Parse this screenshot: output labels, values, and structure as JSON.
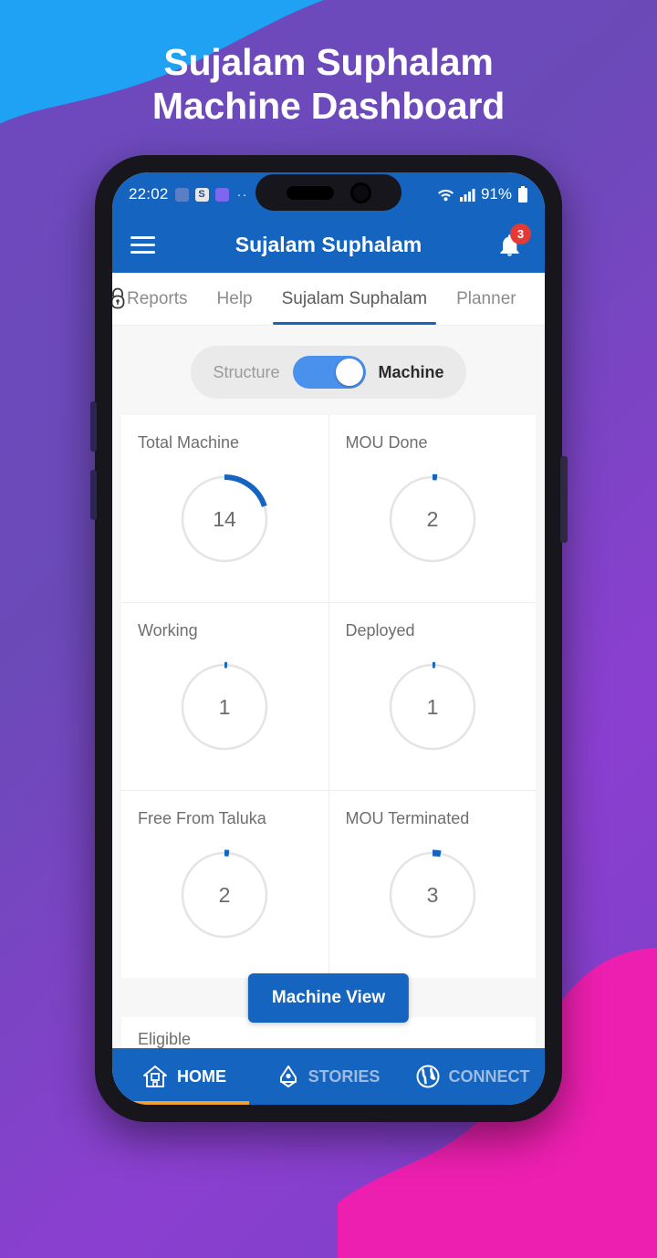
{
  "poster": {
    "headline_line1": "Sujalam Suphalam",
    "headline_line2": "Machine Dashboard",
    "bg_purple": "#6f49c0",
    "bg_cyan": "#1fa2f3",
    "bg_pink": "#ed1fb0"
  },
  "statusbar": {
    "time": "22:02",
    "app_icons": [
      "copy-icon",
      "s-app-icon",
      "chat-app-icon"
    ],
    "overflow": "··",
    "wifi": "wifi-icon",
    "signal": "signal-bars-icon",
    "battery_percent": "91%",
    "battery": "battery-icon"
  },
  "appbar": {
    "menu_icon": "hamburger-menu-icon",
    "title": "Sujalam Suphalam",
    "bell_icon": "notification-bell-icon",
    "badge_count": "3",
    "bg": "#1565c0"
  },
  "tabs": {
    "lock_icon": "lock-icon",
    "items": [
      {
        "label": "Reports",
        "active": false
      },
      {
        "label": "Help",
        "active": false
      },
      {
        "label": "Sujalam Suphalam",
        "active": true
      },
      {
        "label": "Planner",
        "active": false
      }
    ],
    "indicator_color": "#1565c0"
  },
  "toggle": {
    "left_label": "Structure",
    "right_label": "Machine",
    "selected": "Machine",
    "on": true,
    "track_color": "#4a90ed"
  },
  "chart_data": {
    "type": "gauge",
    "title": "Machine Dashboard Gauges",
    "arc_color": "#1565c0",
    "track_color": "#e4e4e4",
    "total": 14,
    "categories": [
      "Total Machine",
      "MOU Done",
      "Working",
      "Deployed",
      "Free From Taluka",
      "MOU Terminated",
      "Eligible"
    ],
    "values": [
      14,
      2,
      1,
      1,
      2,
      3,
      null
    ],
    "gauges": [
      {
        "label": "Total Machine",
        "value": "14",
        "fraction": 0.2
      },
      {
        "label": "MOU Done",
        "value": "2",
        "fraction": 0.012
      },
      {
        "label": "Working",
        "value": "1",
        "fraction": 0.008
      },
      {
        "label": "Deployed",
        "value": "1",
        "fraction": 0.008
      },
      {
        "label": "Free From Taluka",
        "value": "2",
        "fraction": 0.015
      },
      {
        "label": "MOU Terminated",
        "value": "3",
        "fraction": 0.028
      }
    ],
    "partial_label": "Eligible"
  },
  "actions": {
    "machine_view": "Machine View"
  },
  "bottomnav": {
    "items": [
      {
        "label": "HOME",
        "icon": "home-icon",
        "active": true
      },
      {
        "label": "STORIES",
        "icon": "pen-nib-icon",
        "active": false
      },
      {
        "label": "CONNECT",
        "icon": "globe-icon",
        "active": false
      }
    ],
    "active_underline": "#f0a030"
  }
}
